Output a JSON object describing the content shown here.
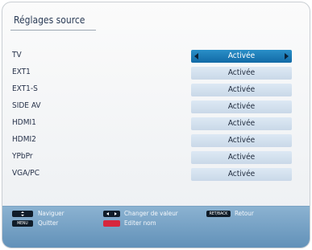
{
  "title": "Réglages source",
  "rows": [
    {
      "label": "TV",
      "value": "Activée",
      "selected": true
    },
    {
      "label": "EXT1",
      "value": "Activée"
    },
    {
      "label": "EXT1-S",
      "value": "Activée"
    },
    {
      "label": "SIDE AV",
      "value": "Activée"
    },
    {
      "label": "HDMI1",
      "value": "Activée"
    },
    {
      "label": "HDMI2",
      "value": "Activée"
    },
    {
      "label": "YPbPr",
      "value": "Activée"
    },
    {
      "label": "VGA/PC",
      "value": "Activée"
    }
  ],
  "footer": {
    "navigate": "Naviguer",
    "change_value": "Changer de valeur",
    "back_key": "RET/BACK",
    "back": "Retour",
    "menu_key": "MENU",
    "quit": "Quitter",
    "edit_name": "Editer nom"
  },
  "colors": {
    "selected_bg": "#1a78b8",
    "value_bg": "#d3e1ee",
    "footer_bg": "#769fc3",
    "edit_key": "#d7263d"
  }
}
